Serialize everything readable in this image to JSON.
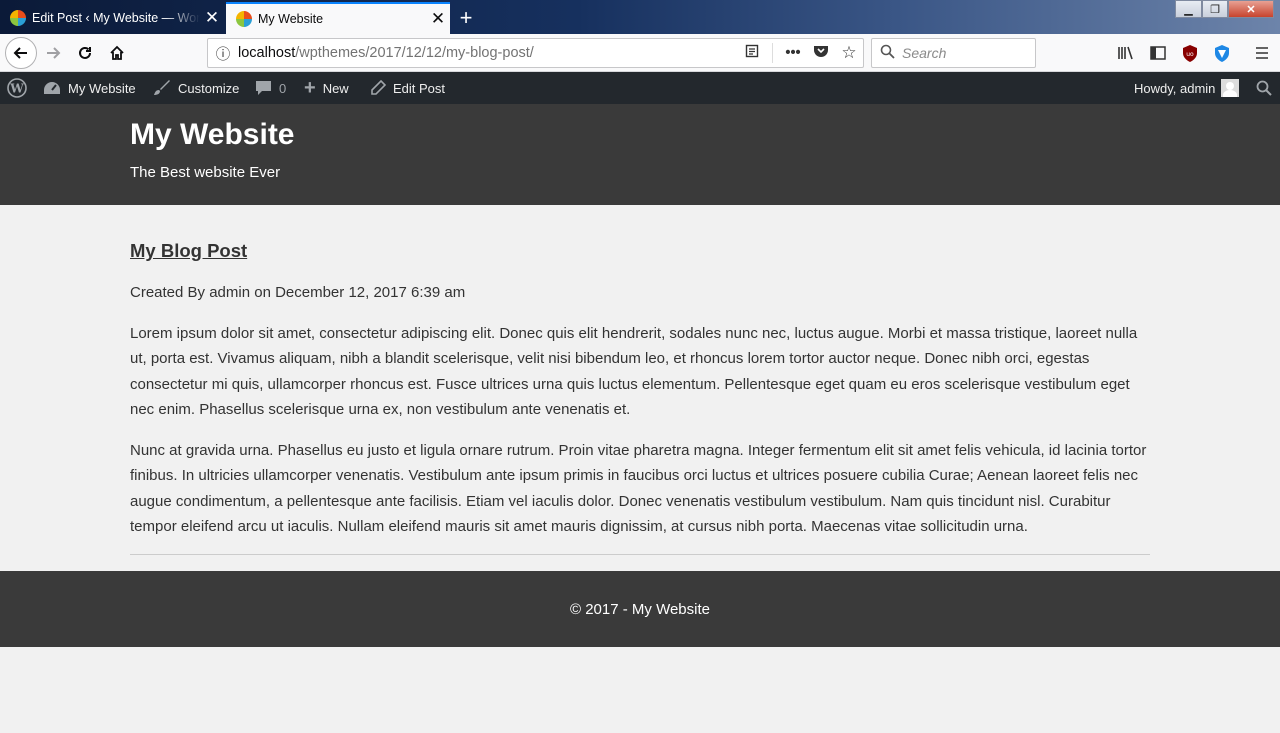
{
  "browser": {
    "tabs": [
      {
        "title": "Edit Post ‹ My Website — WordPress",
        "active": false
      },
      {
        "title": "My Website",
        "active": true
      }
    ],
    "url": {
      "host": "localhost",
      "path": "/wpthemes/2017/12/12/my-blog-post/"
    },
    "search_placeholder": "Search",
    "accent": "#0a84ff"
  },
  "admin_bar": {
    "site_name": "My Website",
    "customize": "Customize",
    "comments_count": "0",
    "new": "New",
    "edit_post": "Edit Post",
    "howdy": "Howdy, admin"
  },
  "site": {
    "title": "My Website",
    "description": "The Best website Ever"
  },
  "post": {
    "title": "My Blog Post",
    "meta": "Created By admin on December 12, 2017 6:39 am",
    "paragraphs": [
      "Lorem ipsum dolor sit amet, consectetur adipiscing elit. Donec quis elit hendrerit, sodales nunc nec, luctus augue. Morbi et massa tristique, laoreet nulla ut, porta est. Vivamus aliquam, nibh a blandit scelerisque, velit nisi bibendum leo, et rhoncus lorem tortor auctor neque. Donec nibh orci, egestas consectetur mi quis, ullamcorper rhoncus est. Fusce ultrices urna quis luctus elementum. Pellentesque eget quam eu eros scelerisque vestibulum eget nec enim. Phasellus scelerisque urna ex, non vestibulum ante venenatis et.",
      "Nunc at gravida urna. Phasellus eu justo et ligula ornare rutrum. Proin vitae pharetra magna. Integer fermentum elit sit amet felis vehicula, id lacinia tortor finibus. In ultricies ullamcorper venenatis. Vestibulum ante ipsum primis in faucibus orci luctus et ultrices posuere cubilia Curae; Aenean laoreet felis nec augue condimentum, a pellentesque ante facilisis. Etiam vel iaculis dolor. Donec venenatis vestibulum vestibulum. Nam quis tincidunt nisl. Curabitur tempor eleifend arcu ut iaculis. Nullam eleifend mauris sit amet mauris dignissim, at cursus nibh porta. Maecenas vitae sollicitudin urna."
    ]
  },
  "footer": {
    "text": "© 2017 - My Website"
  }
}
